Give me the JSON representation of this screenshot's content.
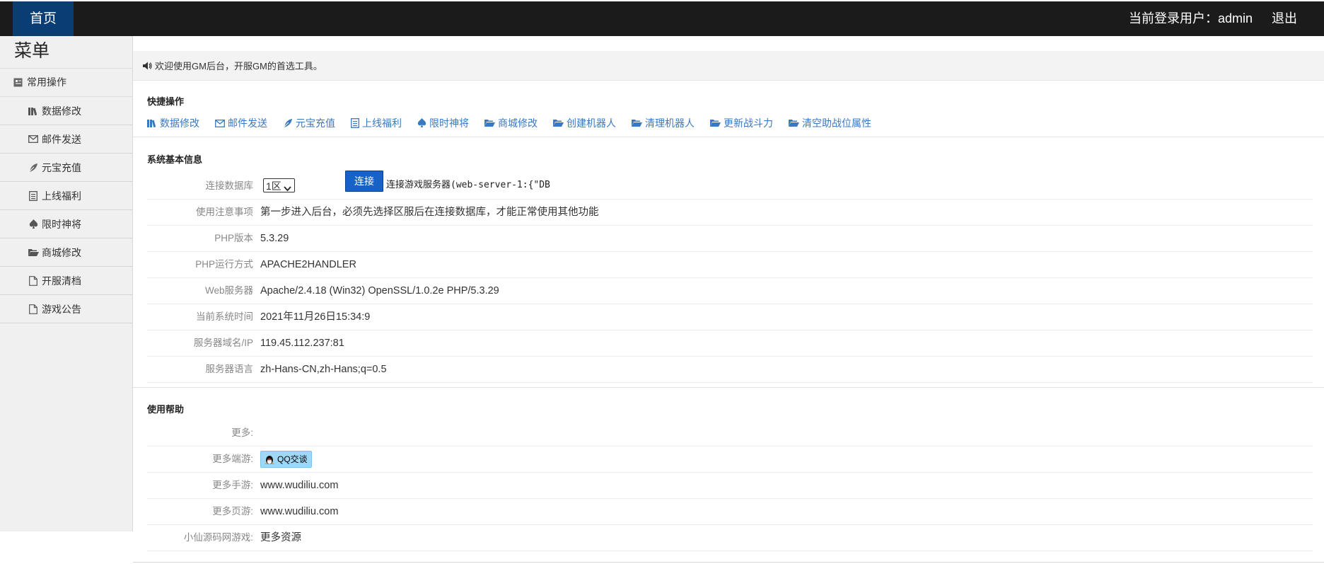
{
  "topbar": {
    "home_label": "首页",
    "user_text": "当前登录用户：admin",
    "logout_label": "退出"
  },
  "sidebar": {
    "title": "菜单",
    "group_label": "常用操作",
    "items": [
      {
        "label": "数据修改",
        "icon": "books-icon"
      },
      {
        "label": "邮件发送",
        "icon": "envelope-icon"
      },
      {
        "label": "元宝充值",
        "icon": "leaf-icon"
      },
      {
        "label": "上线福利",
        "icon": "list-icon"
      },
      {
        "label": "限时神将",
        "icon": "spade-icon"
      },
      {
        "label": "商城修改",
        "icon": "folder-open-icon"
      },
      {
        "label": "开服清档",
        "icon": "file-icon"
      },
      {
        "label": "游戏公告",
        "icon": "file-icon"
      }
    ]
  },
  "welcome": {
    "text": "欢迎使用GM后台，开服GM的首选工具。"
  },
  "quick": {
    "title": "快捷操作",
    "links": [
      {
        "label": "数据修改",
        "icon": "books-icon"
      },
      {
        "label": "邮件发送",
        "icon": "envelope-icon"
      },
      {
        "label": "元宝充值",
        "icon": "leaf-icon"
      },
      {
        "label": "上线福利",
        "icon": "list-icon"
      },
      {
        "label": "限时神将",
        "icon": "spade-icon"
      },
      {
        "label": "商城修改",
        "icon": "folder-open-icon"
      },
      {
        "label": "创建机器人",
        "icon": "folder-open-icon"
      },
      {
        "label": "清理机器人",
        "icon": "folder-open-icon"
      },
      {
        "label": "更新战斗力",
        "icon": "folder-open-icon"
      },
      {
        "label": "清空助战位属性",
        "icon": "folder-open-icon"
      }
    ]
  },
  "sysinfo": {
    "title": "系统基本信息",
    "db_label": "连接数据库",
    "db_select": "1区",
    "connect_label": "连接",
    "server_text": "连接游戏服务器(web-server-1:{\"DB",
    "rows": [
      {
        "label": "使用注意事项",
        "value": "第一步进入后台，必须先选择区服后在连接数据库，才能正常使用其他功能"
      },
      {
        "label": "PHP版本",
        "value": "5.3.29"
      },
      {
        "label": "PHP运行方式",
        "value": "APACHE2HANDLER"
      },
      {
        "label": "Web服务器",
        "value": "Apache/2.4.18 (Win32) OpenSSL/1.0.2e PHP/5.3.29"
      },
      {
        "label": "当前系统时间",
        "value": "2021年11月26日15:34:9"
      },
      {
        "label": "服务器域名/IP",
        "value": "119.45.112.237:81"
      },
      {
        "label": "服务器语言",
        "value": "zh-Hans-CN,zh-Hans;q=0.5"
      }
    ]
  },
  "help": {
    "title": "使用帮助",
    "more_label": "更多:",
    "duan_label": "更多端游:",
    "qq_label": "QQ交谈",
    "mobile_label": "更多手游:",
    "mobile_value": "www.wudiliu.com",
    "web_label": "更多页游:",
    "web_value": "www.wudiliu.com",
    "source_label": "小仙源码网游戏:",
    "source_link": "更多资源"
  }
}
